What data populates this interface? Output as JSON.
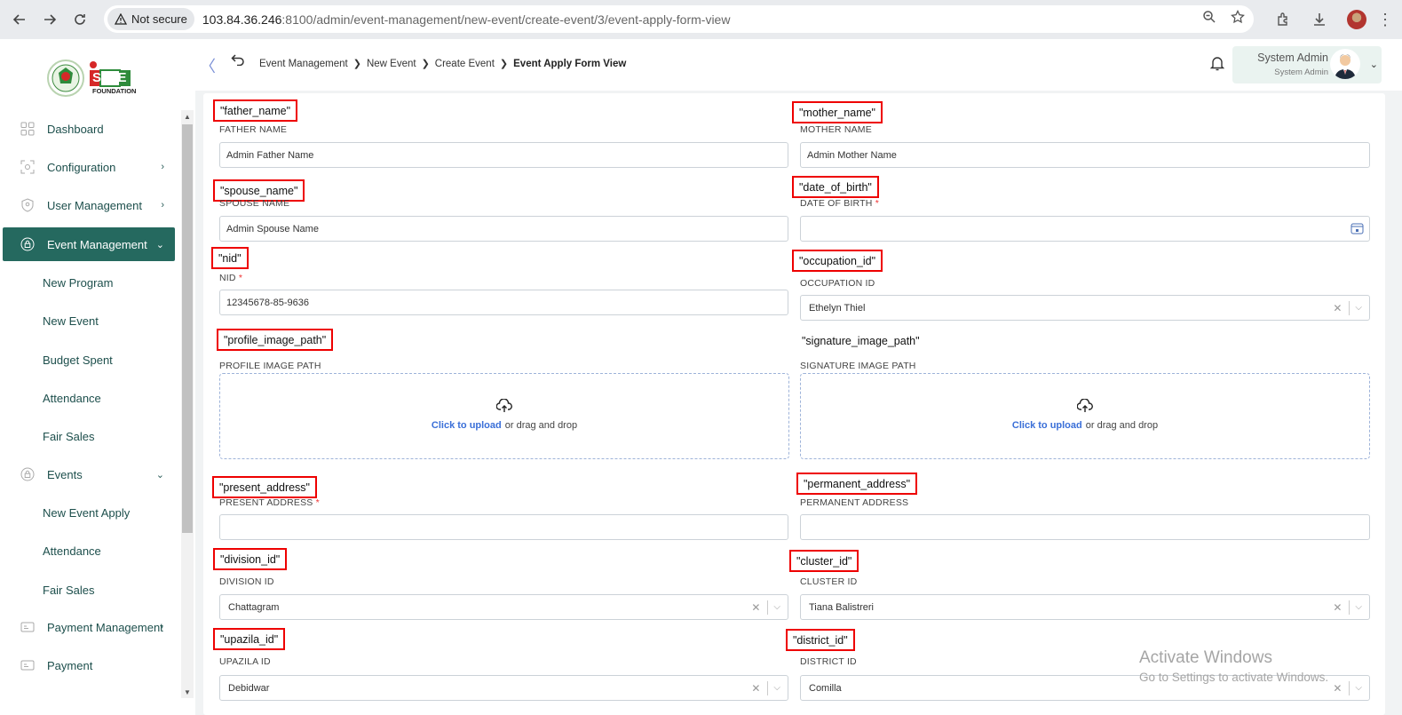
{
  "browser": {
    "security_label": "Not secure",
    "url_host": "103.84.36.246",
    "url_path": ":8100/admin/event-management/new-event/create-event/3/event-apply-form-view"
  },
  "sidebar": {
    "logo_text": "SME",
    "logo_subtext": "FOUNDATION",
    "items": [
      {
        "label": "Dashboard"
      },
      {
        "label": "Configuration"
      },
      {
        "label": "User Management"
      },
      {
        "label": "Event Management"
      },
      {
        "label": "Events"
      },
      {
        "label": "Payment Management"
      },
      {
        "label": "Payment"
      }
    ],
    "event_management_sub": [
      "New Program",
      "New Event",
      "Budget Spent",
      "Attendance",
      "Fair Sales"
    ],
    "events_sub": [
      "New Event Apply",
      "Attendance",
      "Fair Sales"
    ]
  },
  "header": {
    "breadcrumb": [
      "Event Management",
      "New Event",
      "Create Event",
      "Event Apply Form View"
    ],
    "user_name": "System Admin",
    "user_role": "System Admin"
  },
  "form": {
    "father_name": {
      "key": "\"father_name\"",
      "label": "FATHER NAME",
      "value": "Admin Father Name"
    },
    "mother_name": {
      "key": "\"mother_name\"",
      "label": "MOTHER NAME",
      "value": "Admin Mother Name"
    },
    "spouse_name": {
      "key": "\"spouse_name\"",
      "label": "SPOUSE NAME",
      "value": "Admin Spouse Name"
    },
    "date_of_birth": {
      "key": "\"date_of_birth\"",
      "label": "DATE OF BIRTH",
      "value": ""
    },
    "nid": {
      "key": "\"nid\"",
      "label": "NID",
      "value": "12345678-85-9636"
    },
    "occupation_id": {
      "key": "\"occupation_id\"",
      "label": "OCCUPATION ID",
      "value": "Ethelyn Thiel"
    },
    "profile_image_path": {
      "key": "\"profile_image_path\"",
      "label": "PROFILE IMAGE PATH"
    },
    "signature_image_path": {
      "key": "\"signature_image_path\"",
      "label": "SIGNATURE IMAGE PATH"
    },
    "present_address": {
      "key": "\"present_address\"",
      "label": "PRESENT ADDRESS",
      "value": ""
    },
    "permanent_address": {
      "key": "\"permanent_address\"",
      "label": "PERMANENT ADDRESS",
      "value": ""
    },
    "division_id": {
      "key": "\"division_id\"",
      "label": "DIVISION ID",
      "value": "Chattagram"
    },
    "cluster_id": {
      "key": "\"cluster_id\"",
      "label": "CLUSTER ID",
      "value": "Tiana Balistreri"
    },
    "upazila_id": {
      "key": "\"upazila_id\"",
      "label": "UPAZILA ID",
      "value": "Debidwar"
    },
    "district_id": {
      "key": "\"district_id\"",
      "label": "DISTRICT ID",
      "value": "Comilla"
    },
    "upload_link": "Click to upload",
    "upload_rest": "or drag and drop",
    "required_mark": "*"
  },
  "watermark": {
    "line1": "Activate Windows",
    "line2": "Go to Settings to activate Windows."
  },
  "colors": {
    "sidebar_active": "#25695f",
    "annotation_border": "#e00000",
    "upload_link": "#3a6fd8"
  }
}
